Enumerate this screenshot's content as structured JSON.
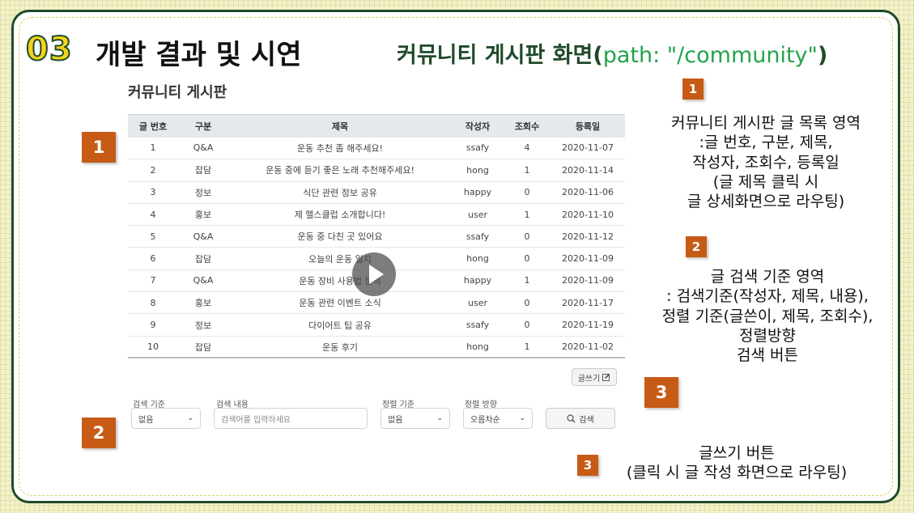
{
  "header": {
    "number": "03",
    "title": "개발 결과 및 시연",
    "subtitle_main": "커뮤니티 게시판 화면(",
    "subtitle_path": "path: \"/community\"",
    "subtitle_close": ")"
  },
  "board": {
    "title": "커뮤니티 게시판",
    "columns": [
      "글 번호",
      "구분",
      "제목",
      "작성자",
      "조회수",
      "등록일"
    ],
    "rows": [
      [
        "1",
        "Q&A",
        "운동 추천 좀 해주세요!",
        "ssafy",
        "4",
        "2020-11-07"
      ],
      [
        "2",
        "잡담",
        "운동 중에 듣기 좋은 노래 추천해주세요!",
        "hong",
        "1",
        "2020-11-14"
      ],
      [
        "3",
        "정보",
        "식단 관련 정보 공유",
        "happy",
        "0",
        "2020-11-06"
      ],
      [
        "4",
        "홍보",
        "제 헬스클럽 소개합니다!",
        "user",
        "1",
        "2020-11-10"
      ],
      [
        "5",
        "Q&A",
        "운동 중 다친 곳 있어요",
        "ssafy",
        "0",
        "2020-11-12"
      ],
      [
        "6",
        "잡담",
        "오늘의 운동 일지",
        "hong",
        "0",
        "2020-11-09"
      ],
      [
        "7",
        "Q&A",
        "운동 장비 사용법 문의",
        "happy",
        "1",
        "2020-11-09"
      ],
      [
        "8",
        "홍보",
        "운동 관련 이벤트 소식",
        "user",
        "0",
        "2020-11-17"
      ],
      [
        "9",
        "정보",
        "다이어트 팁 공유",
        "ssafy",
        "0",
        "2020-11-19"
      ],
      [
        "10",
        "잡담",
        "운동 후기",
        "hong",
        "1",
        "2020-11-02"
      ]
    ],
    "write_button": "글쓰기"
  },
  "search": {
    "criteria_label": "검색 기준",
    "criteria_value": "없음",
    "content_label": "검색 내용",
    "content_placeholder": "검색어를 입력하세요",
    "sort_label": "정렬 기준",
    "sort_value": "없음",
    "direction_label": "정렬 방향",
    "direction_value": "오름차순",
    "button": "검색"
  },
  "annotations": {
    "badge_1": "1",
    "badge_2": "2",
    "badge_3": "3",
    "desc_1": [
      "커뮤니티 게시판 글 목록 영역",
      ":글 번호, 구분, 제목,",
      "작성자, 조회수, 등록일",
      "(글 제목 클릭 시",
      "글 상세화면으로 라우팅)"
    ],
    "desc_2": [
      "글 검색 기준 영역",
      ": 검색기준(작성자, 제목, 내용),",
      "정렬 기준(글쓴이, 제목, 조회수),",
      "정렬방향",
      "검색 버튼"
    ],
    "desc_3": [
      "글쓰기 버튼",
      "(클릭 시 글 작성 화면으로 라우팅)"
    ]
  },
  "colors": {
    "accent_orange": "#c75b16",
    "title_green": "#1f4a2a",
    "path_green": "#21a44b",
    "number_yellow": "#f4d21b"
  }
}
